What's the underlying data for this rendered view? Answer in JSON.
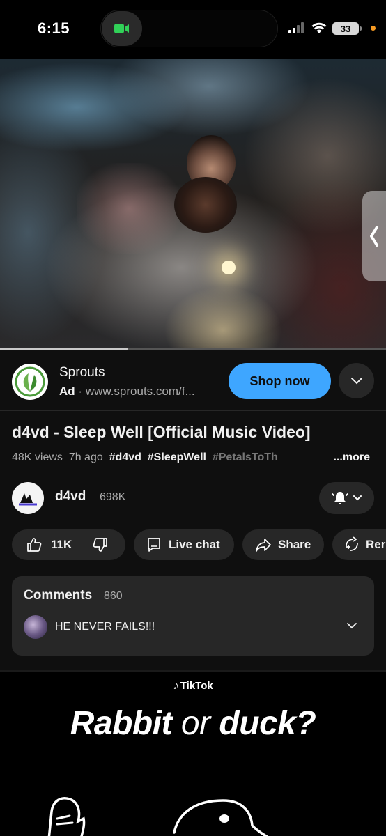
{
  "status_bar": {
    "time": "6:15",
    "battery": "33"
  },
  "video": {
    "progress": 0.33
  },
  "ad": {
    "name": "Sprouts",
    "label": "Ad",
    "separator": "·",
    "url": "www.sprouts.com/f...",
    "cta": "Shop now"
  },
  "video_info": {
    "title": "d4vd - Sleep Well [Official Music Video]",
    "views": "48K views",
    "age": "7h ago",
    "tags": [
      "#d4vd",
      "#SleepWell",
      "#PetalsToTh"
    ],
    "more": "...more"
  },
  "channel": {
    "name": "d4vd",
    "subscribers": "698K"
  },
  "actions": {
    "likes": "11K",
    "live_chat": "Live chat",
    "share": "Share",
    "remix": "Rer"
  },
  "comments": {
    "heading": "Comments",
    "count": "860",
    "top_comment": "HE NEVER FAILS!!!"
  },
  "promo": {
    "brand": "TikTok",
    "headline_a": "Rabbit",
    "headline_or": "or",
    "headline_b": "duck?"
  },
  "colors": {
    "accent": "#3ea6ff",
    "background": "#0f0f0f",
    "surface": "#272727"
  }
}
